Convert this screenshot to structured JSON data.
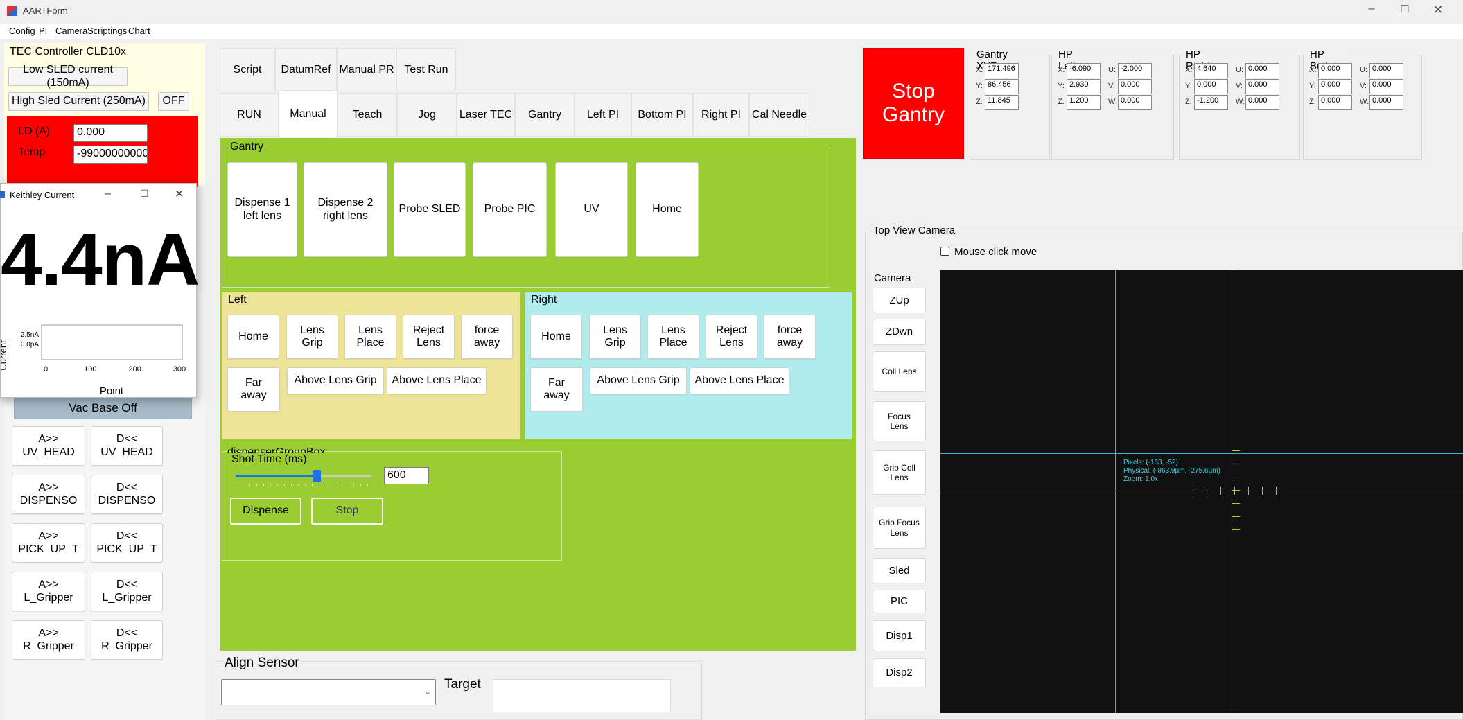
{
  "window": {
    "title": "AARTForm"
  },
  "menu": [
    "Config",
    "PI",
    "Camera",
    "Scriptings",
    "Chart"
  ],
  "tec": {
    "title": "TEC Controller CLD10x",
    "low_btn": "Low SLED current (150mA)",
    "high_btn": "High Sled Current (250mA)",
    "off_btn": "OFF",
    "ld_label": "LD (A)",
    "ld_value": "0.000",
    "temp_label": "Temp",
    "temp_value": "-99000000000"
  },
  "keithley": {
    "title": "Keithley Current",
    "big_value": "4.4nA",
    "ylabel": "Current",
    "xlabel": "Point"
  },
  "chart_data": {
    "type": "line",
    "xlabel": "Point",
    "ylabel": "Current",
    "x_ticks": [
      "0",
      "100",
      "200",
      "300"
    ],
    "y_ticks": [
      "2.5nA",
      "0.0pA"
    ],
    "xlim": [
      0,
      300
    ]
  },
  "vac_btn": "Vac Base Off",
  "valves": [
    [
      "A>>\nUV_HEAD",
      "D<<\nUV_HEAD"
    ],
    [
      "A>>\nDISPENSO",
      "D<<\nDISPENSO"
    ],
    [
      "A>>\nPICK_UP_T",
      "D<<\nPICK_UP_T"
    ],
    [
      "A>>\nL_Gripper",
      "D<<\nL_Gripper"
    ],
    [
      "A>>\nR_Gripper",
      "D<<\nR_Gripper"
    ]
  ],
  "tabs_top": [
    "Script",
    "DatumRef",
    "Manual PR",
    "Test Run"
  ],
  "tabs_bottom": [
    "RUN",
    "Manual",
    "Teach",
    "Jog",
    "Laser TEC",
    "Gantry",
    "Left PI",
    "Bottom PI",
    "Right PI",
    "Cal Needle"
  ],
  "gantry": {
    "title": "Gantry",
    "buttons": [
      "Dispense 1\nleft lens",
      "Dispense 2\nright lens",
      "Probe SLED",
      "Probe PIC",
      "UV",
      "Home"
    ]
  },
  "left": {
    "title": "Left",
    "row1": [
      "Home",
      "Lens\nGrip",
      "Lens\nPlace",
      "Reject\nLens",
      "force\naway"
    ],
    "row2": [
      "Far\naway",
      "Above Lens Grip",
      "Above Lens Place"
    ]
  },
  "right": {
    "title": "Right",
    "row1": [
      "Home",
      "Lens\nGrip",
      "Lens\nPlace",
      "Reject\nLens",
      "force\naway"
    ],
    "row2": [
      "Far\naway",
      "Above Lens Grip",
      "Above Lens Place"
    ]
  },
  "dispenser": {
    "title": "dispenserGroupBox",
    "shot_label": "Shot Time (ms)",
    "shot_value": "600",
    "slider_fraction": 0.6,
    "dispense_btn": "Dispense",
    "stop_btn": "Stop"
  },
  "align": {
    "title": "Align Sensor",
    "target_label": "Target"
  },
  "stop_gantry": "Stop\nGantry",
  "positions": [
    {
      "title": "Gantry XYZ",
      "rows": [
        [
          "X:",
          "171.496"
        ],
        [
          "Y:",
          "86.456"
        ],
        [
          "Z:",
          "11.845"
        ]
      ]
    },
    {
      "title": "HP Left",
      "rows": [
        [
          "X:",
          "-6.090",
          "U:",
          "-2.000"
        ],
        [
          "Y:",
          "2.930",
          "V:",
          "0.000"
        ],
        [
          "Z:",
          "1.200",
          "W:",
          "0.000"
        ]
      ]
    },
    {
      "title": "HP Right",
      "rows": [
        [
          "X:",
          "4.640",
          "U:",
          "0.000"
        ],
        [
          "Y:",
          "0.000",
          "V:",
          "0.000"
        ],
        [
          "Z:",
          "-1.200",
          "W:",
          "0.000"
        ]
      ]
    },
    {
      "title": "HP Bottom",
      "rows": [
        [
          "X:",
          "0.000",
          "U:",
          "0.000"
        ],
        [
          "Y:",
          "0.000",
          "V:",
          "0.000"
        ],
        [
          "Z:",
          "0.000",
          "W:",
          "0.000"
        ]
      ]
    }
  ],
  "camera": {
    "title": "Top View Camera",
    "mouse_move": "Mouse click move",
    "panel_label": "Camera",
    "buttons": [
      "ZUp",
      "ZDwn",
      "Coll Lens",
      "Focus\nLens",
      "Grip Coll\nLens",
      "Grip Focus\nLens",
      "Sled",
      "PIC",
      "Disp1",
      "Disp2"
    ],
    "overlay": [
      "Pixels: (-163, -52)",
      "Physical: (-863.9µm, -275.6µm)",
      "Zoom: 1.0x"
    ]
  },
  "colors": {
    "green": "#9acd32",
    "red": "#ff0000",
    "yellow": "#eee497",
    "cyan": "#b0ecec"
  }
}
